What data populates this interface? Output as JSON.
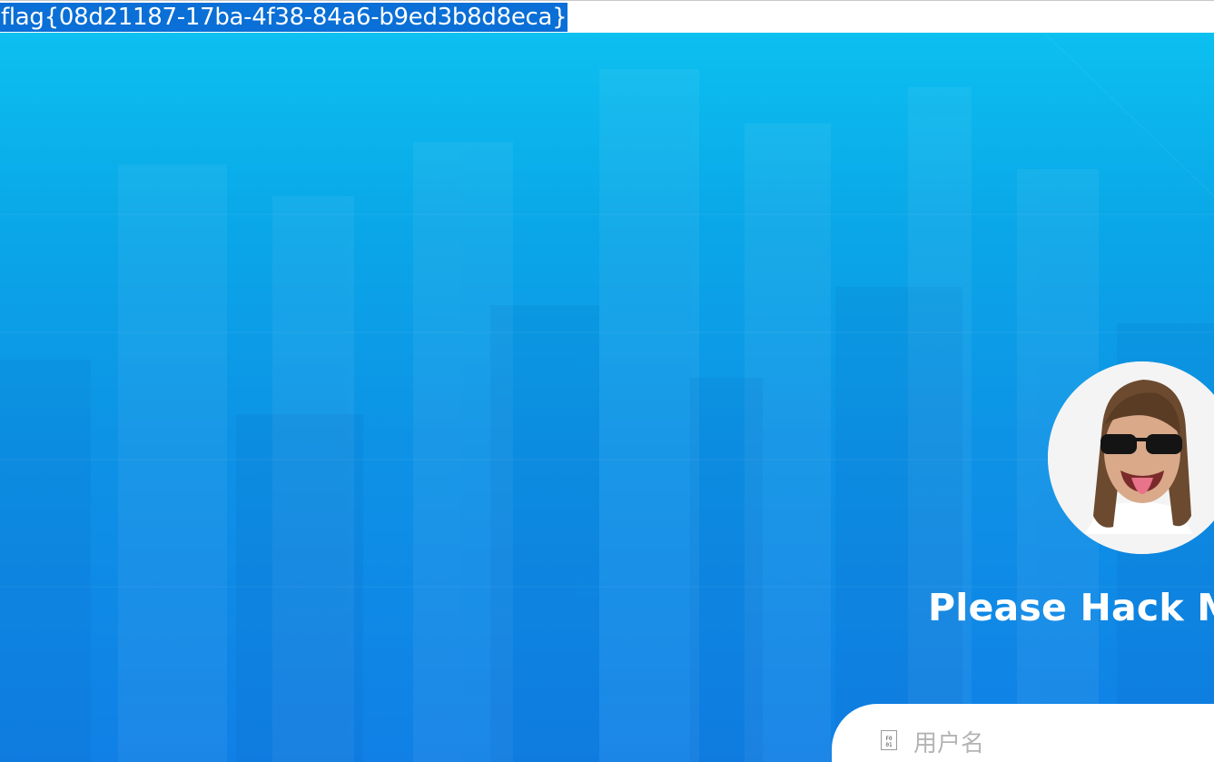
{
  "top": {
    "flag_text": "flag{08d21187-17ba-4f38-84a6-b9ed3b8d8eca}"
  },
  "hero": {
    "title": "Please Hack Me"
  },
  "login": {
    "username_placeholder": "用户名",
    "username_value": ""
  },
  "icons": {
    "user_icon": "broken-image-icon"
  },
  "colors": {
    "selection": "#0a6fd6",
    "gradient_top": "#0cc0f0",
    "gradient_bottom": "#1080e6",
    "title": "#ffffff"
  }
}
